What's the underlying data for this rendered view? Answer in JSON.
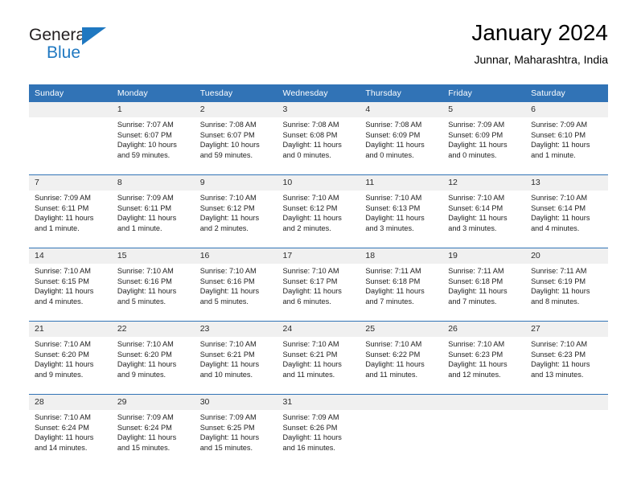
{
  "brand": {
    "name_part1": "General",
    "name_part2": "Blue",
    "logo_icon": "triangle-logo-icon"
  },
  "header": {
    "title": "January 2024",
    "subtitle": "Junnar, Maharashtra, India"
  },
  "calendar": {
    "weekday_headers": [
      "Sunday",
      "Monday",
      "Tuesday",
      "Wednesday",
      "Thursday",
      "Friday",
      "Saturday"
    ],
    "accent_color": "#3173b6",
    "daynum_band_color": "#f0f0f0",
    "weeks": [
      [
        {
          "day": "",
          "lines": []
        },
        {
          "day": "1",
          "lines": [
            "Sunrise: 7:07 AM",
            "Sunset: 6:07 PM",
            "Daylight: 10 hours",
            "and 59 minutes."
          ]
        },
        {
          "day": "2",
          "lines": [
            "Sunrise: 7:08 AM",
            "Sunset: 6:07 PM",
            "Daylight: 10 hours",
            "and 59 minutes."
          ]
        },
        {
          "day": "3",
          "lines": [
            "Sunrise: 7:08 AM",
            "Sunset: 6:08 PM",
            "Daylight: 11 hours",
            "and 0 minutes."
          ]
        },
        {
          "day": "4",
          "lines": [
            "Sunrise: 7:08 AM",
            "Sunset: 6:09 PM",
            "Daylight: 11 hours",
            "and 0 minutes."
          ]
        },
        {
          "day": "5",
          "lines": [
            "Sunrise: 7:09 AM",
            "Sunset: 6:09 PM",
            "Daylight: 11 hours",
            "and 0 minutes."
          ]
        },
        {
          "day": "6",
          "lines": [
            "Sunrise: 7:09 AM",
            "Sunset: 6:10 PM",
            "Daylight: 11 hours",
            "and 1 minute."
          ]
        }
      ],
      [
        {
          "day": "7",
          "lines": [
            "Sunrise: 7:09 AM",
            "Sunset: 6:11 PM",
            "Daylight: 11 hours",
            "and 1 minute."
          ]
        },
        {
          "day": "8",
          "lines": [
            "Sunrise: 7:09 AM",
            "Sunset: 6:11 PM",
            "Daylight: 11 hours",
            "and 1 minute."
          ]
        },
        {
          "day": "9",
          "lines": [
            "Sunrise: 7:10 AM",
            "Sunset: 6:12 PM",
            "Daylight: 11 hours",
            "and 2 minutes."
          ]
        },
        {
          "day": "10",
          "lines": [
            "Sunrise: 7:10 AM",
            "Sunset: 6:12 PM",
            "Daylight: 11 hours",
            "and 2 minutes."
          ]
        },
        {
          "day": "11",
          "lines": [
            "Sunrise: 7:10 AM",
            "Sunset: 6:13 PM",
            "Daylight: 11 hours",
            "and 3 minutes."
          ]
        },
        {
          "day": "12",
          "lines": [
            "Sunrise: 7:10 AM",
            "Sunset: 6:14 PM",
            "Daylight: 11 hours",
            "and 3 minutes."
          ]
        },
        {
          "day": "13",
          "lines": [
            "Sunrise: 7:10 AM",
            "Sunset: 6:14 PM",
            "Daylight: 11 hours",
            "and 4 minutes."
          ]
        }
      ],
      [
        {
          "day": "14",
          "lines": [
            "Sunrise: 7:10 AM",
            "Sunset: 6:15 PM",
            "Daylight: 11 hours",
            "and 4 minutes."
          ]
        },
        {
          "day": "15",
          "lines": [
            "Sunrise: 7:10 AM",
            "Sunset: 6:16 PM",
            "Daylight: 11 hours",
            "and 5 minutes."
          ]
        },
        {
          "day": "16",
          "lines": [
            "Sunrise: 7:10 AM",
            "Sunset: 6:16 PM",
            "Daylight: 11 hours",
            "and 5 minutes."
          ]
        },
        {
          "day": "17",
          "lines": [
            "Sunrise: 7:10 AM",
            "Sunset: 6:17 PM",
            "Daylight: 11 hours",
            "and 6 minutes."
          ]
        },
        {
          "day": "18",
          "lines": [
            "Sunrise: 7:11 AM",
            "Sunset: 6:18 PM",
            "Daylight: 11 hours",
            "and 7 minutes."
          ]
        },
        {
          "day": "19",
          "lines": [
            "Sunrise: 7:11 AM",
            "Sunset: 6:18 PM",
            "Daylight: 11 hours",
            "and 7 minutes."
          ]
        },
        {
          "day": "20",
          "lines": [
            "Sunrise: 7:11 AM",
            "Sunset: 6:19 PM",
            "Daylight: 11 hours",
            "and 8 minutes."
          ]
        }
      ],
      [
        {
          "day": "21",
          "lines": [
            "Sunrise: 7:10 AM",
            "Sunset: 6:20 PM",
            "Daylight: 11 hours",
            "and 9 minutes."
          ]
        },
        {
          "day": "22",
          "lines": [
            "Sunrise: 7:10 AM",
            "Sunset: 6:20 PM",
            "Daylight: 11 hours",
            "and 9 minutes."
          ]
        },
        {
          "day": "23",
          "lines": [
            "Sunrise: 7:10 AM",
            "Sunset: 6:21 PM",
            "Daylight: 11 hours",
            "and 10 minutes."
          ]
        },
        {
          "day": "24",
          "lines": [
            "Sunrise: 7:10 AM",
            "Sunset: 6:21 PM",
            "Daylight: 11 hours",
            "and 11 minutes."
          ]
        },
        {
          "day": "25",
          "lines": [
            "Sunrise: 7:10 AM",
            "Sunset: 6:22 PM",
            "Daylight: 11 hours",
            "and 11 minutes."
          ]
        },
        {
          "day": "26",
          "lines": [
            "Sunrise: 7:10 AM",
            "Sunset: 6:23 PM",
            "Daylight: 11 hours",
            "and 12 minutes."
          ]
        },
        {
          "day": "27",
          "lines": [
            "Sunrise: 7:10 AM",
            "Sunset: 6:23 PM",
            "Daylight: 11 hours",
            "and 13 minutes."
          ]
        }
      ],
      [
        {
          "day": "28",
          "lines": [
            "Sunrise: 7:10 AM",
            "Sunset: 6:24 PM",
            "Daylight: 11 hours",
            "and 14 minutes."
          ]
        },
        {
          "day": "29",
          "lines": [
            "Sunrise: 7:09 AM",
            "Sunset: 6:24 PM",
            "Daylight: 11 hours",
            "and 15 minutes."
          ]
        },
        {
          "day": "30",
          "lines": [
            "Sunrise: 7:09 AM",
            "Sunset: 6:25 PM",
            "Daylight: 11 hours",
            "and 15 minutes."
          ]
        },
        {
          "day": "31",
          "lines": [
            "Sunrise: 7:09 AM",
            "Sunset: 6:26 PM",
            "Daylight: 11 hours",
            "and 16 minutes."
          ]
        },
        {
          "day": "",
          "lines": []
        },
        {
          "day": "",
          "lines": []
        },
        {
          "day": "",
          "lines": []
        }
      ]
    ]
  }
}
